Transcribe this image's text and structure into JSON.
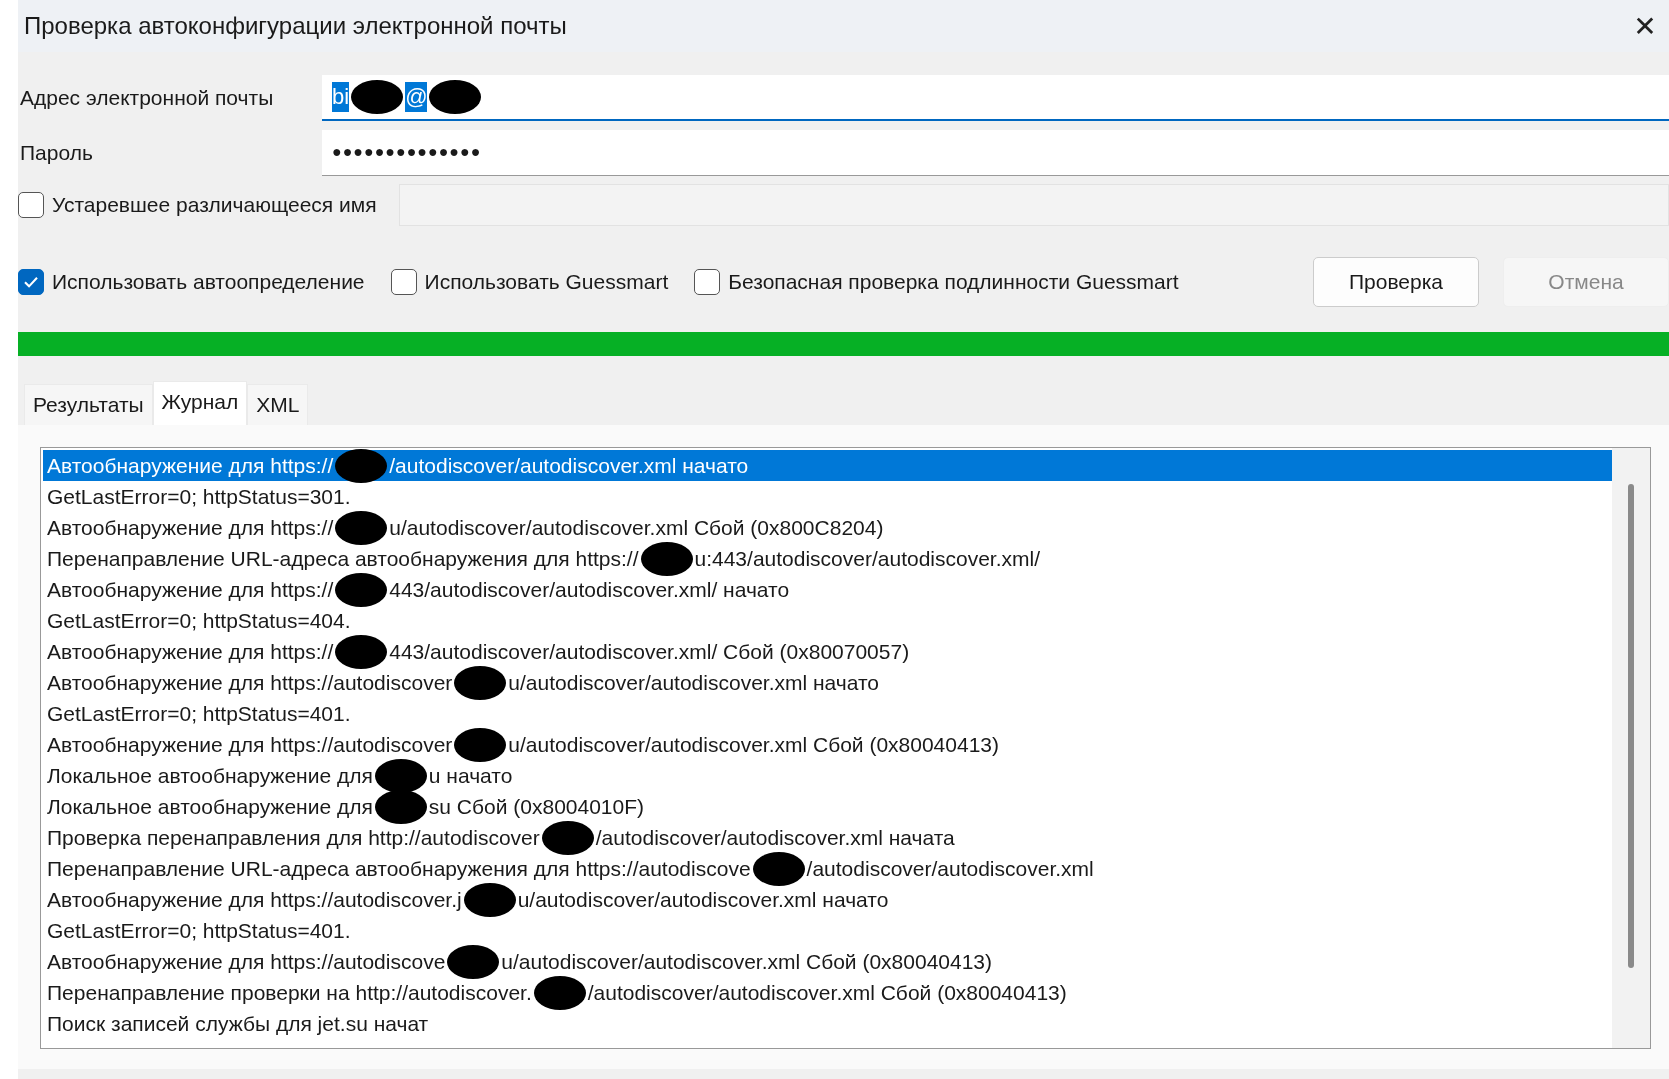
{
  "window": {
    "title": "Проверка автоконфигурации электронной почты",
    "close": "✕"
  },
  "fields": [
    {
      "label": "Адрес электронной почты",
      "kind": "selected-text",
      "segments": [
        "bi",
        "@"
      ]
    },
    {
      "label": "Пароль",
      "kind": "password",
      "segments": [
        "●●●●●●●●●●●●●●"
      ]
    }
  ],
  "legacy": {
    "label": "Устаревшее различающееся имя",
    "checked": false
  },
  "options": [
    {
      "label": "Использовать автоопределение",
      "checked": true
    },
    {
      "label": "Использовать Guessmart",
      "checked": false
    },
    {
      "label": "Безопасная проверка подлинности Guessmart",
      "checked": false
    }
  ],
  "buttons": [
    {
      "label": "Проверка",
      "disabled": false
    },
    {
      "label": "Отмена",
      "disabled": true
    }
  ],
  "progress": {
    "level": 1
  },
  "tabs": [
    {
      "label": "Результаты",
      "selected": false
    },
    {
      "label": "Журнал",
      "selected": true
    },
    {
      "label": "XML",
      "selected": false
    }
  ],
  "log": [
    {
      "selected": true,
      "segments": [
        "Автообнаружение для https://",
        "/autodiscover/autodiscover.xml начато"
      ]
    },
    {
      "selected": false,
      "segments": [
        "GetLastError=0; httpStatus=301."
      ]
    },
    {
      "selected": false,
      "segments": [
        "Автообнаружение для https://",
        "u/autodiscover/autodiscover.xml Сбой (0x800C8204)"
      ]
    },
    {
      "selected": false,
      "segments": [
        "Перенаправление URL-адреса автообнаружения для https://",
        "u:443/autodiscover/autodiscover.xml/"
      ]
    },
    {
      "selected": false,
      "segments": [
        "Автообнаружение для https://",
        "443/autodiscover/autodiscover.xml/ начато"
      ]
    },
    {
      "selected": false,
      "segments": [
        "GetLastError=0; httpStatus=404."
      ]
    },
    {
      "selected": false,
      "segments": [
        "Автообнаружение для https://",
        "443/autodiscover/autodiscover.xml/ Сбой (0x80070057)"
      ]
    },
    {
      "selected": false,
      "segments": [
        "Автообнаружение для https://autodiscover",
        "u/autodiscover/autodiscover.xml начато"
      ]
    },
    {
      "selected": false,
      "segments": [
        "GetLastError=0; httpStatus=401."
      ]
    },
    {
      "selected": false,
      "segments": [
        "Автообнаружение для https://autodiscover",
        "u/autodiscover/autodiscover.xml Сбой (0x80040413)"
      ]
    },
    {
      "selected": false,
      "segments": [
        "Локальное автообнаружение для",
        "u начато"
      ]
    },
    {
      "selected": false,
      "segments": [
        "Локальное автообнаружение для",
        "su Сбой (0x8004010F)"
      ]
    },
    {
      "selected": false,
      "segments": [
        "Проверка перенаправления для http://autodiscover",
        "/autodiscover/autodiscover.xml начата"
      ]
    },
    {
      "selected": false,
      "segments": [
        "Перенаправление URL-адреса автообнаружения для https://autodiscove",
        "/autodiscover/autodiscover.xml"
      ]
    },
    {
      "selected": false,
      "segments": [
        "Автообнаружение для https://autodiscover.j",
        "u/autodiscover/autodiscover.xml начато"
      ]
    },
    {
      "selected": false,
      "segments": [
        "GetLastError=0; httpStatus=401."
      ]
    },
    {
      "selected": false,
      "segments": [
        "Автообнаружение для https://autodiscove",
        "u/autodiscover/autodiscover.xml Сбой (0x80040413)"
      ]
    },
    {
      "selected": false,
      "segments": [
        "Перенаправление проверки на http://autodiscover.",
        "/autodiscover/autodiscover.xml Сбой (0x80040413)"
      ]
    },
    {
      "selected": false,
      "segments": [
        "Поиск записей службы для jet.su начат"
      ]
    }
  ]
}
